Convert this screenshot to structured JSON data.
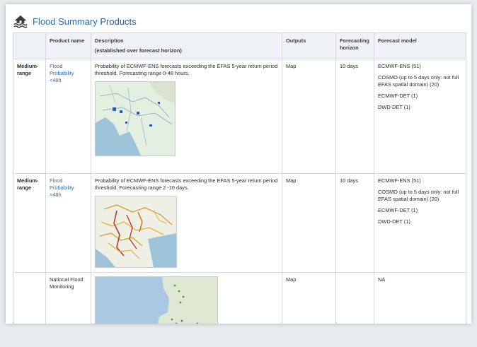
{
  "header": {
    "title_link": "Flood Summary",
    "title_rest": " Products",
    "icon": "flood-house-icon"
  },
  "table": {
    "columns": [
      "",
      "Product name",
      "Description",
      "Outputs",
      "Forecasting horizon",
      "Forecast model"
    ],
    "description_subheader": "(established over forecast horizon)",
    "rows": [
      {
        "range": "Medium-range",
        "product": "Flood Probability <48h",
        "description": "Probability of ECMWF-ENS forecasts exceeding the EFAS 5-year return period threshold. Forecasting range 0-48 hours.",
        "outputs": "Map",
        "horizon": "10 days",
        "models": [
          "ECMWF-ENS (51)",
          "COSMO (up to 5 days only: not full EFAS spatial domain) (20)",
          "ECMWF-DET (1)",
          "DWD-DET (1)"
        ]
      },
      {
        "range": "Medium-range",
        "product": "Flood Probability >48h",
        "description": "Probability of ECMWF-ENS forecasts exceeding the EFAS 5-year return period threshold. Forecasting range 2 -10 days.",
        "outputs": "Map",
        "horizon": "10 days",
        "models": [
          "ECMWF-ENS (51)",
          "COSMO (up to 5 days only: not full EFAS spatial domain) (20)",
          "ECMWF-DET (1)",
          "DWD-DET (1)"
        ]
      },
      {
        "range": "",
        "product": "National Flood Monitoring",
        "description": "",
        "outputs": "Map",
        "horizon": "",
        "models": [
          "NA"
        ]
      }
    ]
  },
  "colors": {
    "link": "#2a6db5",
    "header_bg": "#eef2f6",
    "border": "#d7d7d7"
  }
}
